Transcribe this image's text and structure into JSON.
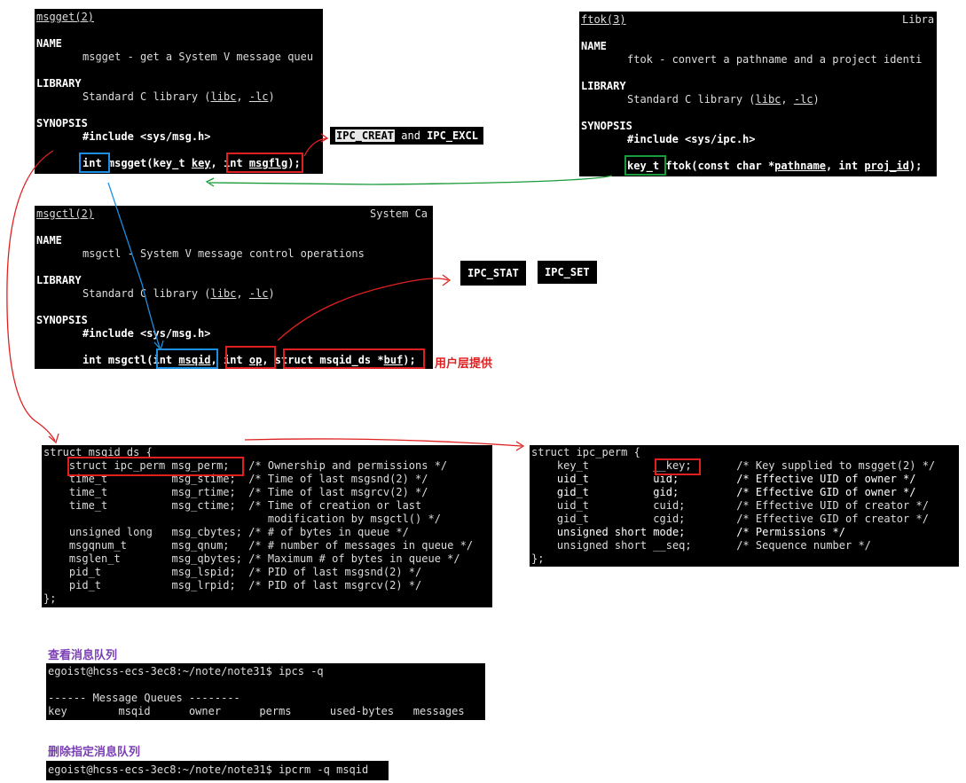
{
  "msgget": {
    "header": "msgget(2)",
    "name_heading": "NAME",
    "name_desc": "msgget - get a System V message queu",
    "library_heading": "LIBRARY",
    "library_pre": "Standard C library (",
    "libc": "libc",
    "library_sep": ", ",
    "lc": "-lc",
    "library_post": ")",
    "synopsis_heading": "SYNOPSIS",
    "include": "#include <sys/msg.h>",
    "ret_type": "int",
    "func": " msgget(key_t ",
    "arg_key": "key",
    "sep": ", ",
    "arg2_type": "int ",
    "arg2": "msgflg",
    "close": ");"
  },
  "ftok": {
    "header": "ftok(3)",
    "header_right": "Libra",
    "name_heading": "NAME",
    "name_desc": "ftok - convert a pathname and a project identi",
    "library_heading": "LIBRARY",
    "library_pre": "Standard C library (",
    "libc": "libc",
    "library_sep": ", ",
    "lc": "-lc",
    "library_post": ")",
    "synopsis_heading": "SYNOPSIS",
    "include": "#include <sys/ipc.h>",
    "ret_type": "key_t",
    "func": " ftok(const char *",
    "arg1": "pathname",
    "sep": ", int ",
    "arg2": "proj_id",
    "close": ");"
  },
  "msgctl": {
    "header": "msgctl(2)",
    "header_right": "System Ca",
    "name_heading": "NAME",
    "name_desc": "msgctl - System V message control operations",
    "library_heading": "LIBRARY",
    "library_pre": "Standard C library (",
    "libc": "libc",
    "library_sep": ", ",
    "lc": "-lc",
    "library_post": ")",
    "synopsis_heading": "SYNOPSIS",
    "include": "#include <sys/msg.h>",
    "func": "int msgctl(",
    "arg1_type": "int ",
    "arg1": "msqid",
    "sep1": ", ",
    "arg2_type": "int ",
    "arg2": "op",
    "sep2": ", ",
    "arg3_type": "struct msqid_ds *",
    "arg3": "buf",
    "close": ");"
  },
  "badges": {
    "ipc_creat": "IPC_CREAT",
    "and_word": " and ",
    "ipc_excl": "IPC_EXCL",
    "ipc_stat": "IPC_STAT",
    "ipc_set": "IPC_SET"
  },
  "annotation_user_provided": "用户层提供",
  "msqid_ds": {
    "lines": [
      "struct msqid_ds {",
      "    struct ipc_perm msg_perm;   /* Ownership and permissions */",
      "    time_t          msg_stime;  /* Time of last msgsnd(2) */",
      "    time_t          msg_rtime;  /* Time of last msgrcv(2) */",
      "    time_t          msg_ctime;  /* Time of creation or last",
      "                                   modification by msgctl() */",
      "    unsigned long   msg_cbytes; /* # of bytes in queue */",
      "    msgqnum_t       msg_qnum;   /* # number of messages in queue */",
      "    msglen_t        msg_qbytes; /* Maximum # of bytes in queue */",
      "    pid_t           msg_lspid;  /* PID of last msgsnd(2) */",
      "    pid_t           msg_lrpid;  /* PID of last msgrcv(2) */",
      "};"
    ]
  },
  "ipc_perm": {
    "lines": [
      "struct ipc_perm {",
      "    key_t          __key;       /* Key supplied to msgget(2) */",
      "    uid_t          uid;         /* Effective UID of owner */",
      "    gid_t          gid;         /* Effective GID of owner */",
      "    uid_t          cuid;        /* Effective UID of creator */",
      "    gid_t          cgid;        /* Effective GID of creator */",
      "    unsigned short mode;        /* Permissions */",
      "    unsigned short __seq;       /* Sequence number */",
      "};"
    ]
  },
  "section_view": {
    "title": "查看消息队列",
    "prompt": "egoist@hcss-ecs-3ec8:~/note/note31$ ipcs -q",
    "blank": "",
    "banner": "------ Message Queues --------",
    "columns": "key        msqid      owner      perms      used-bytes   messages"
  },
  "section_delete": {
    "title": "删除指定消息队列",
    "prompt": "egoist@hcss-ecs-3ec8:~/note/note31$ ipcrm -q msqid"
  },
  "colors": {
    "terminal_bg": "#000000",
    "terminal_text": "#dcdcdc",
    "highlight_red": "#e02020",
    "highlight_blue": "#1c8fe0",
    "highlight_green": "#1a9a3a",
    "section_title": "#7a3fb5"
  }
}
